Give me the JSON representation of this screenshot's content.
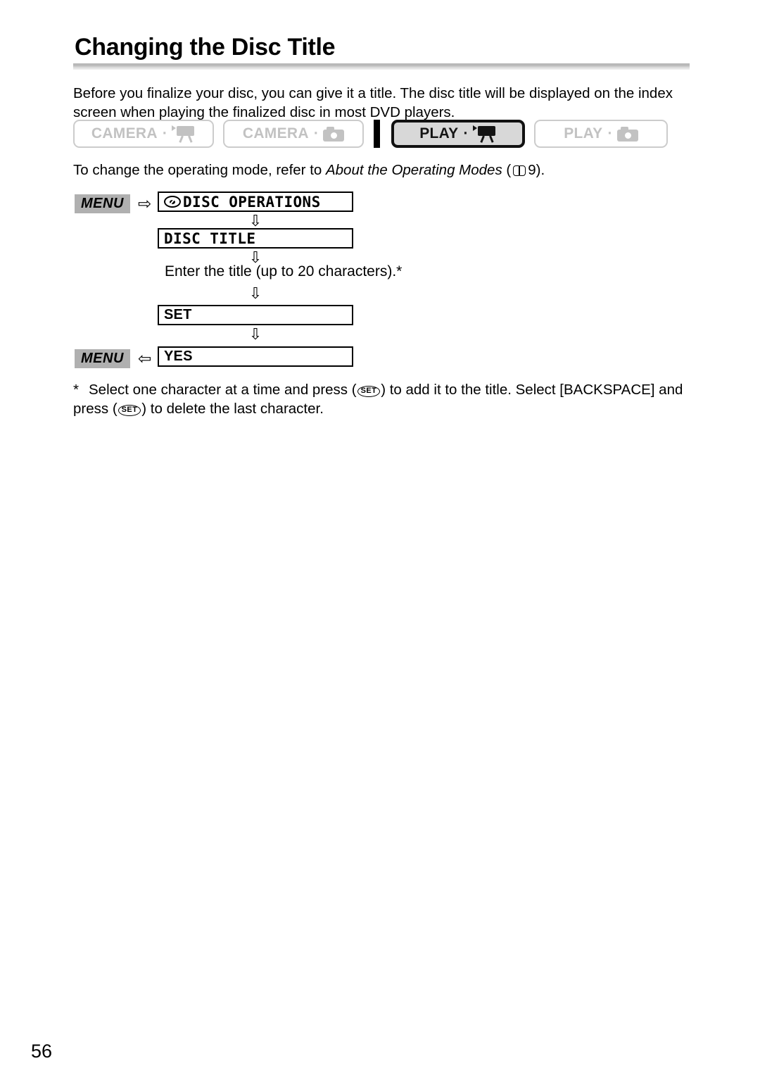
{
  "page": {
    "title": "Changing the Disc Title",
    "number": "56"
  },
  "intro": {
    "text": "Before you finalize your disc, you can give it a title. The disc title will be displayed on the index screen when playing the finalized disc in most DVD players."
  },
  "modes": {
    "buttons": [
      {
        "label": "CAMERA",
        "separator": "·",
        "icon": "movie-camera-icon",
        "state": "inactive"
      },
      {
        "label": "CAMERA",
        "separator": "·",
        "icon": "still-camera-icon",
        "state": "inactive"
      },
      {
        "label": "PLAY",
        "separator": "·",
        "icon": "movie-camera-icon",
        "state": "active"
      },
      {
        "label": "PLAY",
        "separator": "·",
        "icon": "still-camera-icon",
        "state": "inactive"
      }
    ],
    "note_before": "To change the operating mode, refer to ",
    "note_italic": "About the Operating Modes",
    "note_after_open": " (",
    "note_page": "9",
    "note_after_close": ").",
    "book_icon": "book-icon",
    "colors": {
      "active_border": "#111111",
      "active_fill": "#d8d8d8",
      "inactive_border": "#cccccc",
      "inactive_text": "#c2c2c2"
    }
  },
  "flow": {
    "menu_badge_1": "MENU",
    "menu_badge_2": "MENU",
    "arrow_right": "⇨",
    "arrow_left": "⇦",
    "arrow_down": "⇩",
    "steps": {
      "disc_operations": "DISC OPERATIONS",
      "disc_title": "DISC TITLE",
      "enter_title": "Enter the title (up to 20 characters).*",
      "set": "SET",
      "yes": "YES"
    },
    "disc_icon": "disc-icon"
  },
  "footnote": {
    "marker": "*",
    "part1": "Select one character at a time and press (",
    "set_icon_label": "SET",
    "part2": ") to add it to the title. Select [BACKSPACE] and press (",
    "part3": ") to delete the last character."
  }
}
